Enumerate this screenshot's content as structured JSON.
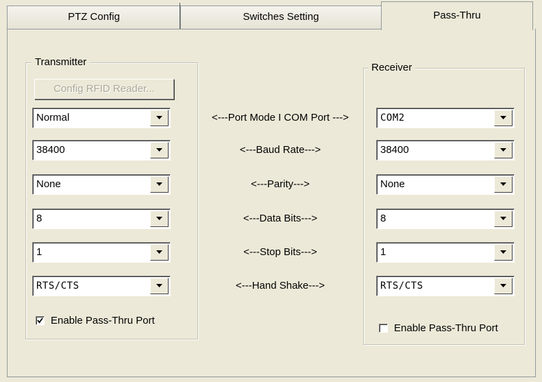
{
  "tabs": [
    {
      "label": "PTZ Config",
      "active": false
    },
    {
      "label": "Switches Setting",
      "active": false
    },
    {
      "label": "Pass-Thru",
      "active": true
    }
  ],
  "transmitter": {
    "title": "Transmitter",
    "config_button_label": "Config RFID Reader...",
    "config_button_enabled": false,
    "port_mode": "Normal",
    "baud_rate": "38400",
    "parity": "None",
    "data_bits": "8",
    "stop_bits": "1",
    "hand_shake": "RTS/CTS",
    "enable_label": "Enable Pass-Thru Port",
    "enable_checked": true
  },
  "receiver": {
    "title": "Receiver",
    "com_port": "COM2",
    "baud_rate": "38400",
    "parity": "None",
    "data_bits": "8",
    "stop_bits": "1",
    "hand_shake": "RTS/CTS",
    "enable_label": "Enable Pass-Thru Port",
    "enable_checked": false
  },
  "labels": {
    "port_mode": "<---Port Mode I COM Port --->",
    "baud_rate": "<---Baud Rate--->",
    "parity": "<---Parity--->",
    "data_bits": "<---Data Bits--->",
    "stop_bits": "<---Stop Bits--->",
    "hand_shake": "<---Hand Shake--->"
  },
  "icons": {
    "dropdown": "chevron-down-icon",
    "check": "checkmark-icon"
  },
  "colors": {
    "dialog_bg": "#ece9d8",
    "border": "#919b9c",
    "disabled_text": "#aca899"
  }
}
